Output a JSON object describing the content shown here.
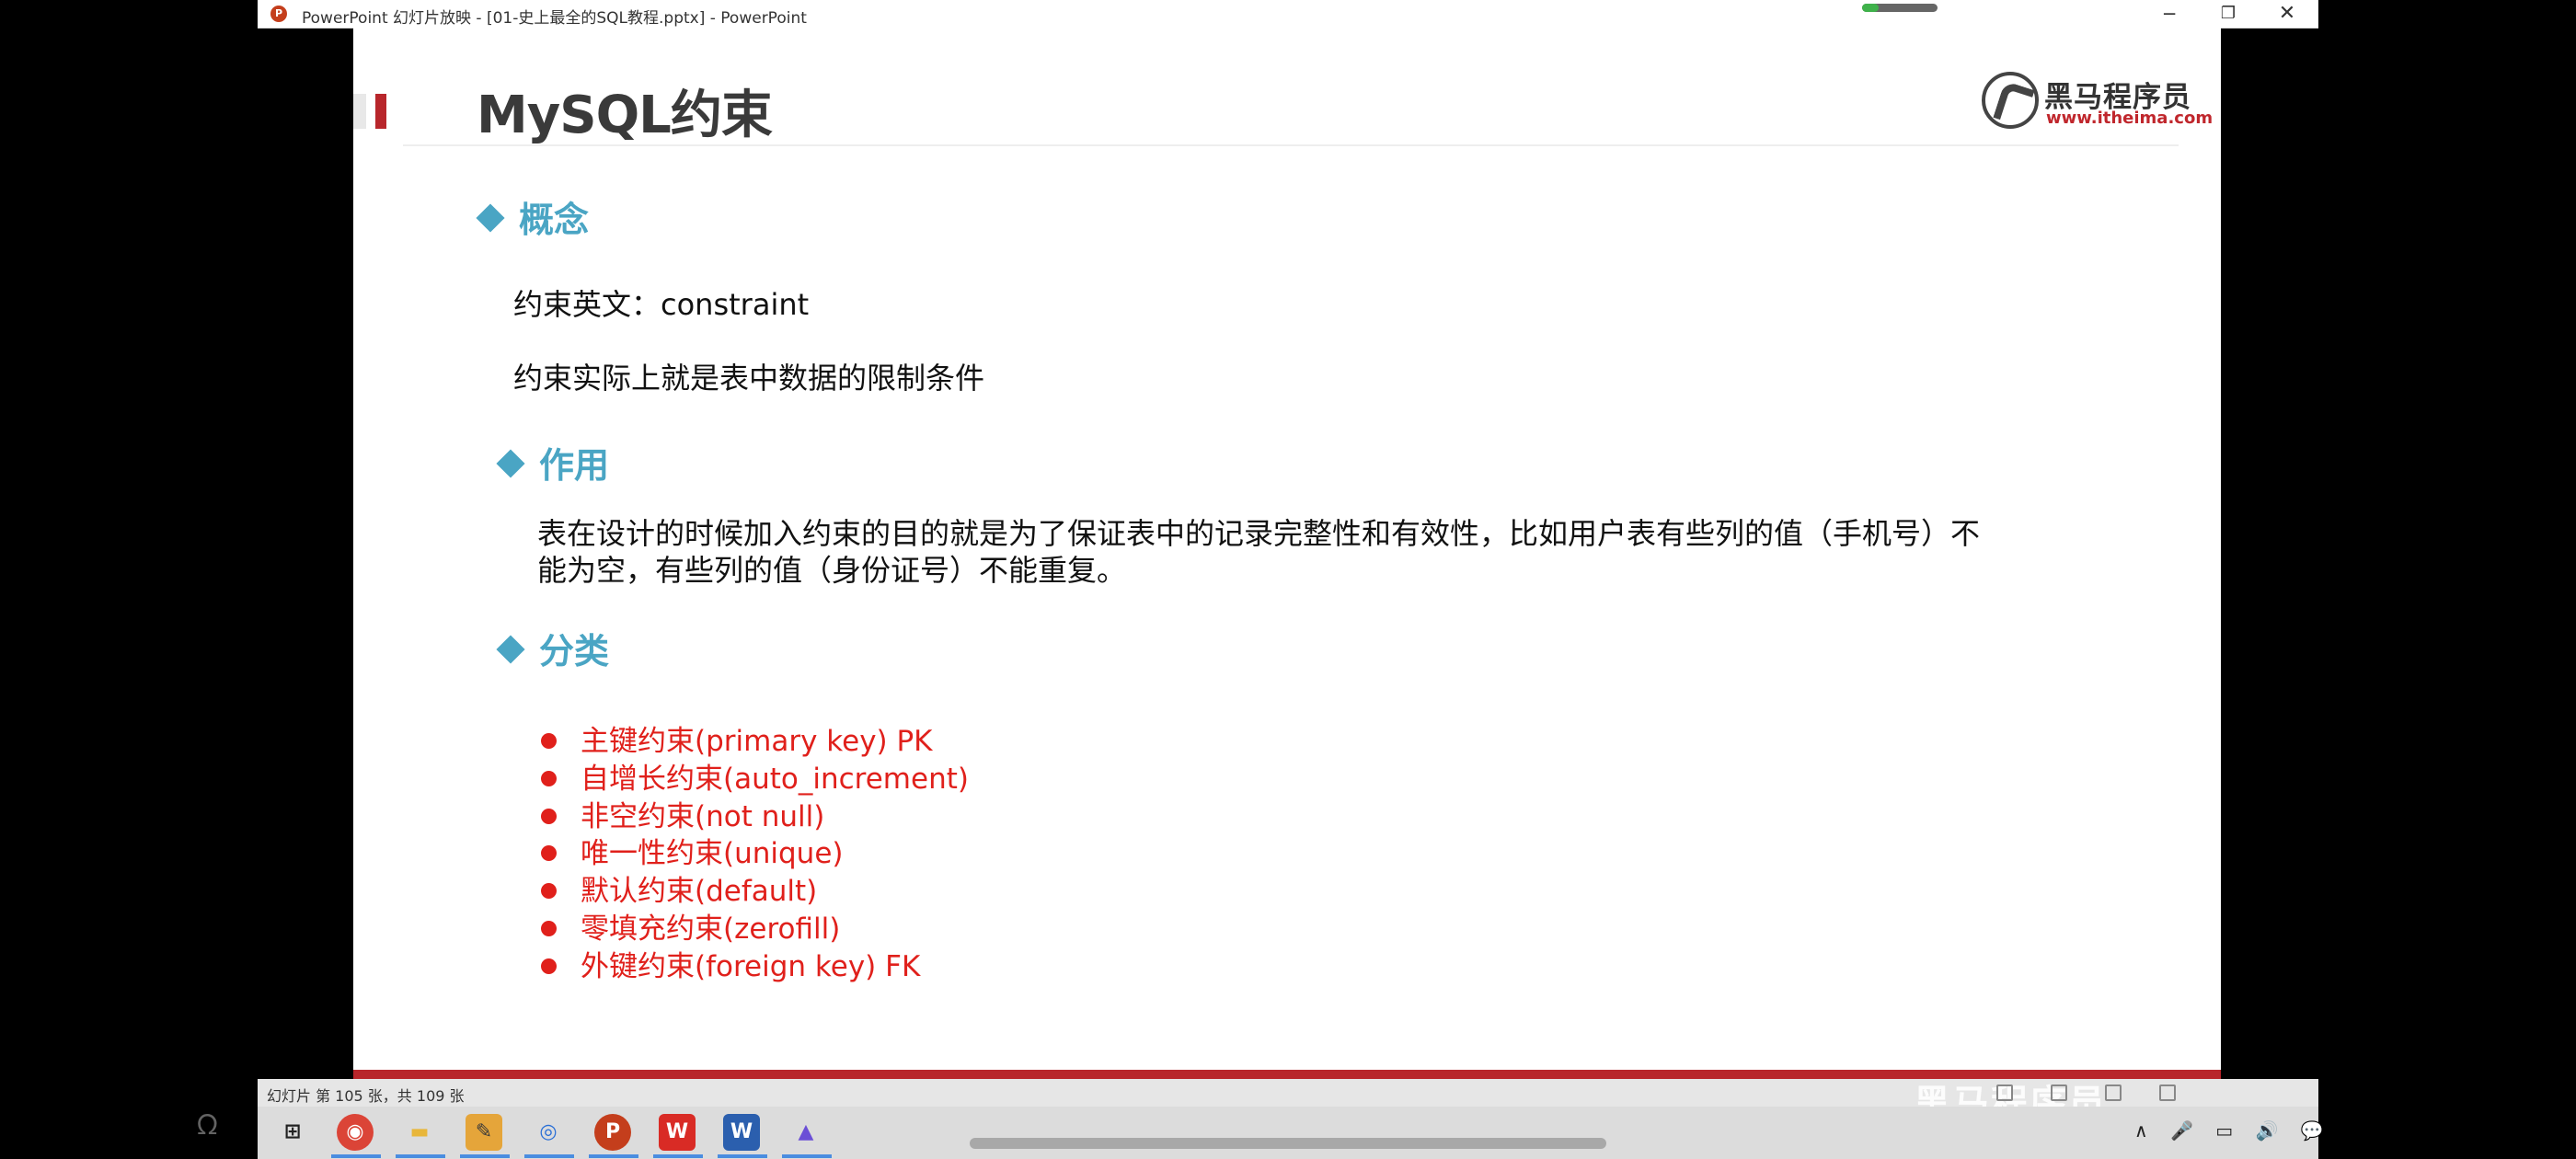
{
  "window": {
    "title": "PowerPoint 幻灯片放映 - [01-史上最全的SQL教程.pptx] - PowerPoint",
    "controls": {
      "minimize": "─",
      "restore": "❐",
      "close": "✕"
    }
  },
  "slide": {
    "title": "MySQL约束",
    "logo": {
      "brand": "黑马程序员",
      "url": "www.itheima.com"
    },
    "sections": {
      "concept": {
        "heading": "概念",
        "lines": [
          "约束英文：constraint",
          "约束实际上就是表中数据的限制条件"
        ]
      },
      "role": {
        "heading": "作用",
        "text": "表在设计的时候加入约束的目的就是为了保证表中的记录完整性和有效性，比如用户表有些列的值（手机号）不能为空，有些列的值（身份证号）不能重复。"
      },
      "classification": {
        "heading": "分类",
        "items": [
          "主键约束(primary key) PK",
          "自增长约束(auto_increment)",
          "非空约束(not null)",
          "唯一性约束(unique)",
          "默认约束(default)",
          "零填充约束(zerofill)",
          "外键约束(foreign key) FK"
        ]
      }
    },
    "colors": {
      "accent": "#4aa5c4",
      "red": "#e0201b",
      "bar": "#b8262b"
    }
  },
  "statusbar": {
    "slide_count": "幻灯片 第 105 张，共 109 张",
    "watermark": "黑马程序员"
  },
  "taskbar": {
    "apps": [
      {
        "icon": "windows-start-icon",
        "glyph": "⊞"
      },
      {
        "icon": "chrome-icon",
        "glyph": "◉"
      },
      {
        "icon": "file-explorer-icon",
        "glyph": "▬"
      },
      {
        "icon": "app-icon",
        "glyph": "✎"
      },
      {
        "icon": "browser-icon",
        "glyph": "◎"
      },
      {
        "icon": "powerpoint-icon",
        "glyph": "P"
      },
      {
        "icon": "wps-icon",
        "glyph": "W"
      },
      {
        "icon": "word-icon",
        "glyph": "W"
      },
      {
        "icon": "mountain-app-icon",
        "glyph": "▲"
      }
    ],
    "tray": [
      "∧",
      "🎤",
      "▭",
      "🔊",
      "💬"
    ]
  }
}
